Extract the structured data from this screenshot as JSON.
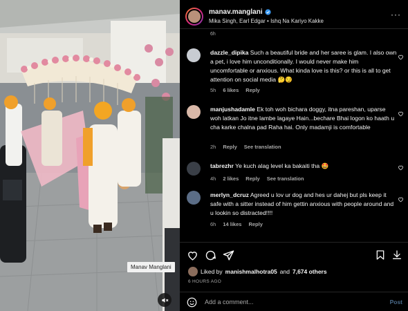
{
  "watermark": "Manav Manglani",
  "header": {
    "username": "manav.manglani",
    "music": "Mika Singh, Earl Edgar • Ishq Na Kariyo Kakke",
    "more": "···"
  },
  "cut_time": "6h",
  "comments": [
    {
      "username": "dazzle_dipika",
      "text": "Such a beautiful bride and her saree is glam. I also own a pet, i love him unconditionally. I would never make him uncomfortable or anxious. What kinda love is this? or this is all to get attention on social media 🤔😏",
      "time": "5h",
      "likes": "6 likes",
      "reply": "Reply",
      "avatar_color": "#c8ccd2"
    },
    {
      "username": "manjushadamle",
      "text": "Ek toh woh bichara doggy, itna pareshan, uparse woh latkan Jo itne lambe lagaye Hain...bechare Bhai logon ko haath u cha karke chalna pad Raha hai. Only madamji is comfortable",
      "time": "2h",
      "reply": "Reply",
      "see_translation": "See translation",
      "avatar_color": "#d9b8a8"
    },
    {
      "username": "tabrezhr",
      "text": "Ye kuch alag level ka bakaiti tha 🤩",
      "time": "4h",
      "likes": "2 likes",
      "reply": "Reply",
      "see_translation": "See translation",
      "avatar_color": "#3a3f47"
    },
    {
      "username": "merlyn_dcruz",
      "text": "Agreed u lov ur dog and hes ur dahej but pls keep it safe with a sitter instead of him gettin anxious with people around and u lookin so distracted!!!!",
      "time": "6h",
      "likes": "14 likes",
      "reply": "Reply",
      "avatar_color": "#5b6d86"
    }
  ],
  "likes": {
    "prefix": "Liked by",
    "user": "manishmalhotra05",
    "joiner": "and",
    "others": "7,674 others"
  },
  "post_time": "6 HOURS AGO",
  "add_comment": {
    "placeholder": "Add a comment...",
    "post_label": "Post"
  },
  "colors": {
    "background": "#000000",
    "verified": "#3897f0",
    "muted_text": "#a8a8a8",
    "post_disabled": "#4a6a8a"
  },
  "icons": [
    "heart-icon",
    "comment-icon",
    "share-icon",
    "bookmark-icon",
    "download-icon",
    "emoji-icon",
    "mute-icon",
    "verified-icon",
    "more-icon"
  ]
}
